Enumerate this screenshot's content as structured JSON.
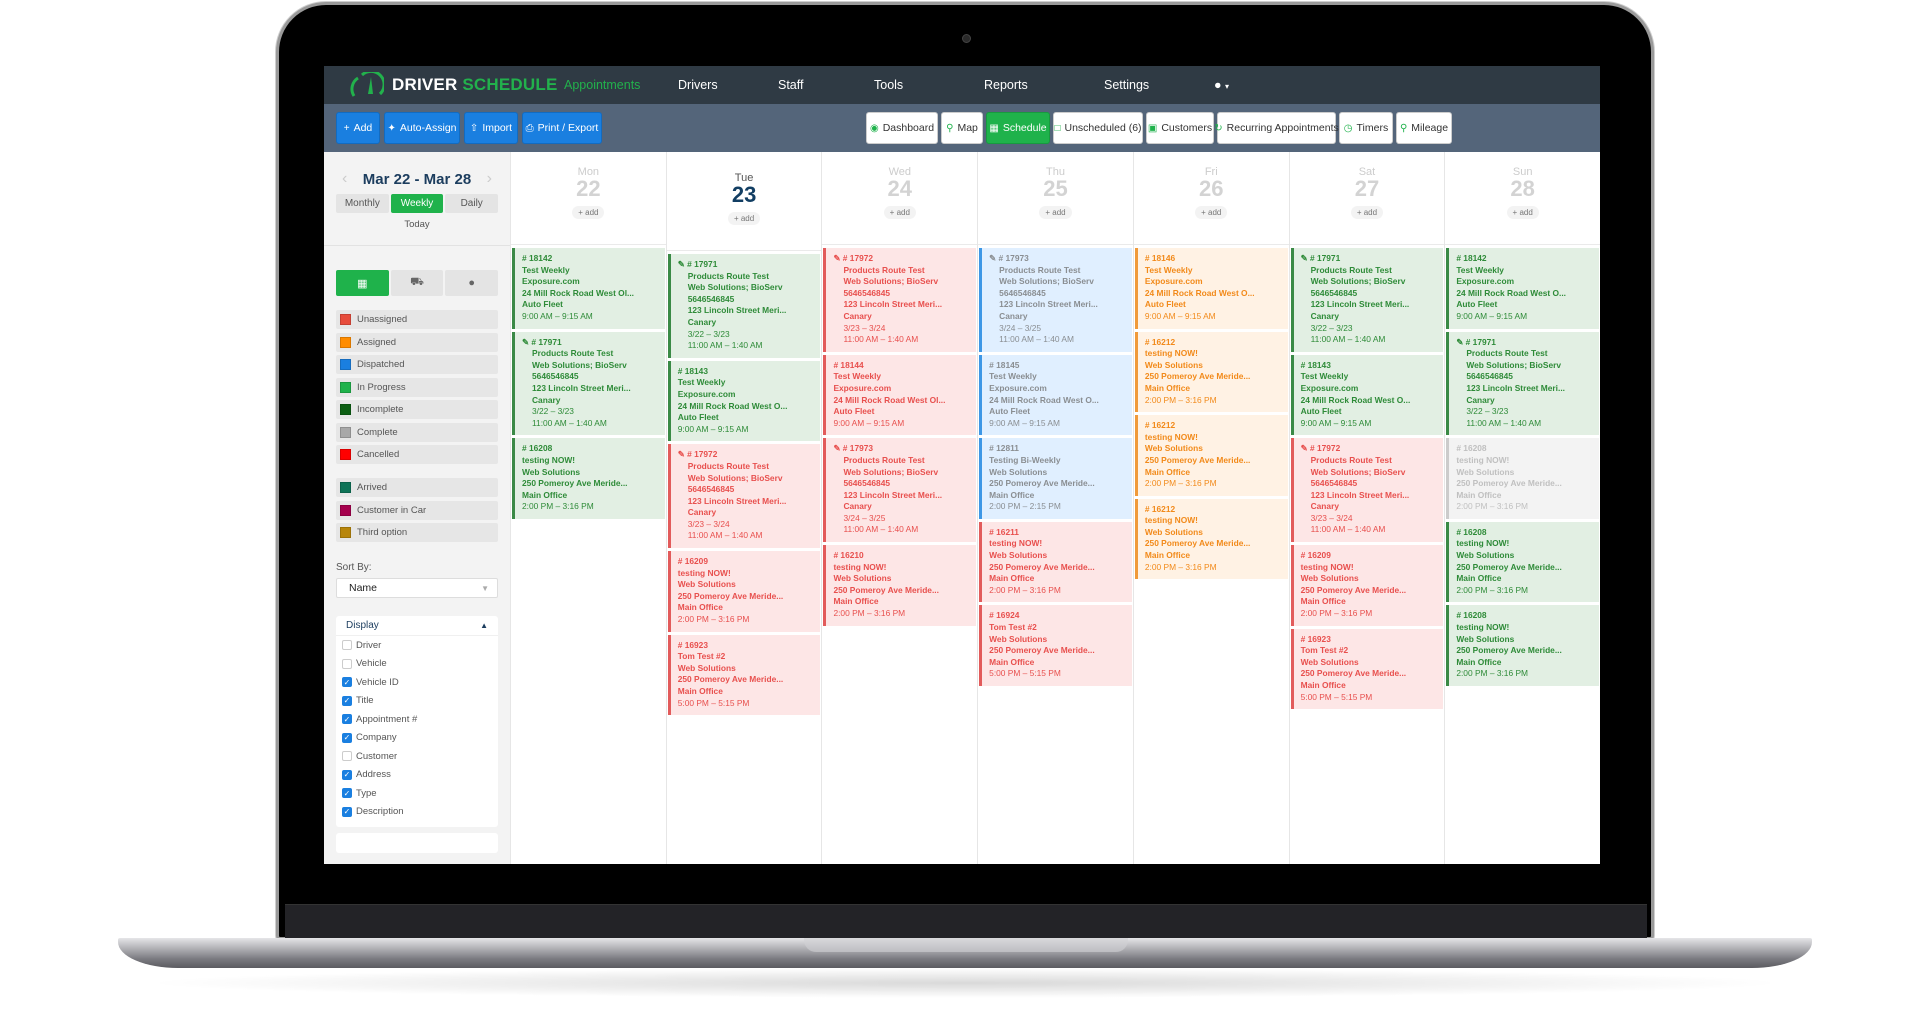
{
  "app": {
    "brand_first": "DRIVER",
    "brand_second": "SCHEDULE",
    "nav": [
      "Appointments",
      "Drivers",
      "Staff",
      "Tools",
      "Reports",
      "Settings"
    ],
    "active_nav": "Appointments",
    "user_menu_icon": "user-icon"
  },
  "toolbar": {
    "left": [
      {
        "label": "Add",
        "icon": "plus-icon"
      },
      {
        "label": "Auto-Assign",
        "icon": "magic-wand-icon"
      },
      {
        "label": "Import",
        "icon": "upload-icon"
      },
      {
        "label": "Print / Export",
        "icon": "print-icon"
      }
    ],
    "right": [
      {
        "label": "Dashboard",
        "icon": "dashboard-icon"
      },
      {
        "label": "Map",
        "icon": "map-marker-icon"
      },
      {
        "label": "Schedule",
        "icon": "calendar-icon",
        "active": true
      },
      {
        "label": "Unscheduled (6)",
        "icon": "calendar-empty-icon"
      },
      {
        "label": "Customers",
        "icon": "contact-card-icon"
      },
      {
        "label": "Recurring Appointments",
        "icon": "refresh-icon"
      },
      {
        "label": "Timers",
        "icon": "clock-icon"
      },
      {
        "label": "Mileage",
        "icon": "map-marker-icon"
      }
    ]
  },
  "sidebar": {
    "date_range": "Mar 22 - Mar 28",
    "view_modes": [
      "Monthly",
      "Weekly",
      "Daily"
    ],
    "active_view": "Weekly",
    "today_label": "Today",
    "view_icons": [
      "calendar-icon",
      "car-icon",
      "person-icon"
    ],
    "status_legend": [
      {
        "label": "Unassigned",
        "color": "#e74c3c"
      },
      {
        "label": "Assigned",
        "color": "#ff8c00"
      },
      {
        "label": "Dispatched",
        "color": "#1a7fe0"
      },
      {
        "label": "In Progress",
        "color": "#1fb24b"
      },
      {
        "label": "Incomplete",
        "color": "#0b5e12"
      },
      {
        "label": "Complete",
        "color": "#a8a8a8"
      },
      {
        "label": "Cancelled",
        "color": "#ff0000"
      }
    ],
    "custom_legend": [
      {
        "label": "Arrived",
        "color": "#0e7357"
      },
      {
        "label": "Customer in Car",
        "color": "#a5004d"
      },
      {
        "label": "Third option",
        "color": "#b8860b"
      }
    ],
    "sort_by_label": "Sort By:",
    "sort_by_value": "Name",
    "display_title": "Display",
    "display_options": [
      {
        "label": "Driver",
        "checked": false
      },
      {
        "label": "Vehicle",
        "checked": false
      },
      {
        "label": "Vehicle ID",
        "checked": true
      },
      {
        "label": "Title",
        "checked": true
      },
      {
        "label": "Appointment #",
        "checked": true
      },
      {
        "label": "Company",
        "checked": true
      },
      {
        "label": "Customer",
        "checked": false
      },
      {
        "label": "Address",
        "checked": true
      },
      {
        "label": "Type",
        "checked": true
      },
      {
        "label": "Description",
        "checked": true
      }
    ]
  },
  "calendar": {
    "add_label": "add",
    "days": [
      {
        "name": "Mon",
        "num": "22",
        "today": false,
        "events": [
          {
            "s": "g",
            "clip": false,
            "lines": [
              "# 18142",
              "Test Weekly",
              "Exposure.com",
              "24 Mill Rock Road West Ol...",
              "Auto Fleet"
            ],
            "times": [
              "9:00 AM – 9:15 AM"
            ]
          },
          {
            "s": "g",
            "clip": true,
            "lines": [
              "# 17971",
              "Products Route Test",
              "Web Solutions; BioServ",
              "5646546845",
              "123 Lincoln Street Meri...",
              "Canary"
            ],
            "times": [
              "3/22 – 3/23",
              "11:00 AM – 1:40 AM"
            ]
          },
          {
            "s": "g",
            "clip": false,
            "lines": [
              "# 16208",
              "testing NOW!",
              "Web Solutions",
              "250 Pomeroy Ave Meride...",
              "Main Office"
            ],
            "times": [
              "2:00 PM – 3:16 PM"
            ]
          }
        ]
      },
      {
        "name": "Tue",
        "num": "23",
        "today": true,
        "events": [
          {
            "s": "g",
            "clip": true,
            "lines": [
              "# 17971",
              "Products Route Test",
              "Web Solutions; BioServ",
              "5646546845",
              "123 Lincoln Street Meri...",
              "Canary"
            ],
            "times": [
              "3/22 – 3/23",
              "11:00 AM – 1:40 AM"
            ]
          },
          {
            "s": "g",
            "clip": false,
            "lines": [
              "# 18143",
              "Test Weekly",
              "Exposure.com",
              "24 Mill Rock Road West O...",
              "Auto Fleet"
            ],
            "times": [
              "9:00 AM – 9:15 AM"
            ]
          },
          {
            "s": "r",
            "clip": true,
            "lines": [
              "# 17972",
              "Products Route Test",
              "Web Solutions; BioServ",
              "5646546845",
              "123 Lincoln Street Meri...",
              "Canary"
            ],
            "times": [
              "3/23 – 3/24",
              "11:00 AM – 1:40 AM"
            ]
          },
          {
            "s": "r",
            "clip": false,
            "lines": [
              "# 16209",
              "testing NOW!",
              "Web Solutions",
              "250 Pomeroy Ave Meride...",
              "Main Office"
            ],
            "times": [
              "2:00 PM – 3:16 PM"
            ]
          },
          {
            "s": "r",
            "clip": false,
            "lines": [
              "# 16923",
              "Tom Test #2",
              "Web Solutions",
              "250 Pomeroy Ave Meride...",
              "Main Office"
            ],
            "times": [
              "5:00 PM – 5:15 PM"
            ]
          }
        ]
      },
      {
        "name": "Wed",
        "num": "24",
        "today": false,
        "events": [
          {
            "s": "r",
            "clip": true,
            "lines": [
              "# 17972",
              "Products Route Test",
              "Web Solutions; BioServ",
              "5646546845",
              "123 Lincoln Street Meri...",
              "Canary"
            ],
            "times": [
              "3/23 – 3/24",
              "11:00 AM – 1:40 AM"
            ]
          },
          {
            "s": "r",
            "clip": false,
            "lines": [
              "# 18144",
              "Test Weekly",
              "Exposure.com",
              "24 Mill Rock Road West Ol...",
              "Auto Fleet"
            ],
            "times": [
              "9:00 AM – 9:15 AM"
            ]
          },
          {
            "s": "r",
            "clip": true,
            "lines": [
              "# 17973",
              "Products Route Test",
              "Web Solutions; BioServ",
              "5646546845",
              "123 Lincoln Street Meri...",
              "Canary"
            ],
            "times": [
              "3/24 – 3/25",
              "11:00 AM – 1:40 AM"
            ]
          },
          {
            "s": "r",
            "clip": false,
            "lines": [
              "# 16210",
              "testing NOW!",
              "Web Solutions",
              "250 Pomeroy Ave Meride...",
              "Main Office"
            ],
            "times": [
              "2:00 PM – 3:16 PM"
            ]
          }
        ]
      },
      {
        "name": "Thu",
        "num": "25",
        "today": false,
        "events": [
          {
            "s": "b",
            "clip": true,
            "lines": [
              "# 17973",
              "Products Route Test",
              "Web Solutions; BioServ",
              "5646546845",
              "123 Lincoln Street Meri...",
              "Canary"
            ],
            "times": [
              "3/24 – 3/25",
              "11:00 AM – 1:40 AM"
            ]
          },
          {
            "s": "b",
            "clip": false,
            "lines": [
              "# 18145",
              "Test Weekly",
              "Exposure.com",
              "24 Mill Rock Road West O...",
              "Auto Fleet"
            ],
            "times": [
              "9:00 AM – 9:15 AM"
            ]
          },
          {
            "s": "b",
            "clip": false,
            "lines": [
              "# 12811",
              "Testing Bi-Weekly",
              "Web Solutions",
              "250 Pomeroy Ave Meride...",
              "Main Office"
            ],
            "times": [
              "2:00 PM – 2:15 PM"
            ]
          },
          {
            "s": "r",
            "clip": false,
            "lines": [
              "# 16211",
              "testing NOW!",
              "Web Solutions",
              "250 Pomeroy Ave Meride...",
              "Main Office"
            ],
            "times": [
              "2:00 PM – 3:16 PM"
            ]
          },
          {
            "s": "r",
            "clip": false,
            "lines": [
              "# 16924",
              "Tom Test #2",
              "Web Solutions",
              "250 Pomeroy Ave Meride...",
              "Main Office"
            ],
            "times": [
              "5:00 PM – 5:15 PM"
            ]
          }
        ]
      },
      {
        "name": "Fri",
        "num": "26",
        "today": false,
        "events": [
          {
            "s": "o",
            "clip": false,
            "lines": [
              "# 18146",
              "Test Weekly",
              "Exposure.com",
              "24 Mill Rock Road West O...",
              "Auto Fleet"
            ],
            "times": [
              "9:00 AM – 9:15 AM"
            ]
          },
          {
            "s": "o",
            "clip": false,
            "lines": [
              "# 16212",
              "testing NOW!",
              "Web Solutions",
              "250 Pomeroy Ave Meride...",
              "Main Office"
            ],
            "times": [
              "2:00 PM – 3:16 PM"
            ]
          },
          {
            "s": "o",
            "clip": false,
            "lines": [
              "# 16212",
              "testing NOW!",
              "Web Solutions",
              "250 Pomeroy Ave Meride...",
              "Main Office"
            ],
            "times": [
              "2:00 PM – 3:16 PM"
            ]
          },
          {
            "s": "o",
            "clip": false,
            "lines": [
              "# 16212",
              "testing NOW!",
              "Web Solutions",
              "250 Pomeroy Ave Meride...",
              "Main Office"
            ],
            "times": [
              "2:00 PM – 3:16 PM"
            ]
          }
        ]
      },
      {
        "name": "Sat",
        "num": "27",
        "today": false,
        "events": [
          {
            "s": "g",
            "clip": true,
            "lines": [
              "# 17971",
              "Products Route Test",
              "Web Solutions; BioServ",
              "5646546845",
              "123 Lincoln Street Meri...",
              "Canary"
            ],
            "times": [
              "3/22 – 3/23",
              "11:00 AM – 1:40 AM"
            ]
          },
          {
            "s": "g",
            "clip": false,
            "lines": [
              "# 18143",
              "Test Weekly",
              "Exposure.com",
              "24 Mill Rock Road West O...",
              "Auto Fleet"
            ],
            "times": [
              "9:00 AM – 9:15 AM"
            ]
          },
          {
            "s": "r",
            "clip": true,
            "lines": [
              "# 17972",
              "Products Route Test",
              "Web Solutions; BioServ",
              "5646546845",
              "123 Lincoln Street Meri...",
              "Canary"
            ],
            "times": [
              "3/23 – 3/24",
              "11:00 AM – 1:40 AM"
            ]
          },
          {
            "s": "r",
            "clip": false,
            "lines": [
              "# 16209",
              "testing NOW!",
              "Web Solutions",
              "250 Pomeroy Ave Meride...",
              "Main Office"
            ],
            "times": [
              "2:00 PM – 3:16 PM"
            ]
          },
          {
            "s": "r",
            "clip": false,
            "lines": [
              "# 16923",
              "Tom Test #2",
              "Web Solutions",
              "250 Pomeroy Ave Meride...",
              "Main Office"
            ],
            "times": [
              "5:00 PM – 5:15 PM"
            ]
          }
        ]
      },
      {
        "name": "Sun",
        "num": "28",
        "today": false,
        "events": [
          {
            "s": "g",
            "clip": false,
            "lines": [
              "# 18142",
              "Test Weekly",
              "Exposure.com",
              "24 Mill Rock Road West O...",
              "Auto Fleet"
            ],
            "times": [
              "9:00 AM – 9:15 AM"
            ]
          },
          {
            "s": "g",
            "clip": true,
            "lines": [
              "# 17971",
              "Products Route Test",
              "Web Solutions; BioServ",
              "5646546845",
              "123 Lincoln Street Meri...",
              "Canary"
            ],
            "times": [
              "3/22 – 3/23",
              "11:00 AM – 1:40 AM"
            ]
          },
          {
            "s": "gr",
            "clip": false,
            "lines": [
              "# 16208",
              "testing NOW!",
              "Web Solutions",
              "250 Pomeroy Ave Meride...",
              "Main Office"
            ],
            "times": [
              "2:00 PM – 3:16 PM"
            ]
          },
          {
            "s": "g",
            "clip": false,
            "lines": [
              "# 16208",
              "testing NOW!",
              "Web Solutions",
              "250 Pomeroy Ave Meride...",
              "Main Office"
            ],
            "times": [
              "2:00 PM – 3:16 PM"
            ]
          },
          {
            "s": "g",
            "clip": false,
            "lines": [
              "# 16208",
              "testing NOW!",
              "Web Solutions",
              "250 Pomeroy Ave Meride...",
              "Main Office"
            ],
            "times": [
              "2:00 PM – 3:16 PM"
            ]
          }
        ]
      }
    ]
  }
}
